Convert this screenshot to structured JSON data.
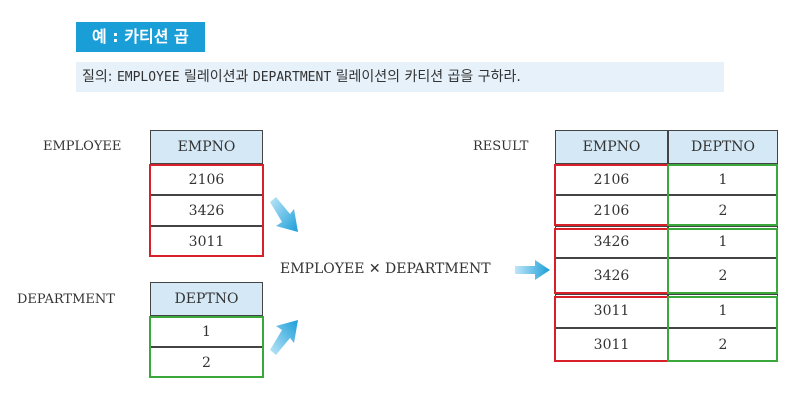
{
  "example_title": "예 : 카티션 곱",
  "query": {
    "prefix": "질의: ",
    "rel1": "EMPLOYEE",
    "mid": " 릴레이션과 ",
    "rel2": "DEPARTMENT",
    "suffix": " 릴레이션의 카티션 곱을 구하라."
  },
  "employee": {
    "label": "EMPLOYEE",
    "header": "EMPNO",
    "rows": [
      "2106",
      "3426",
      "3011"
    ]
  },
  "department": {
    "label": "DEPARTMENT",
    "header": "DEPTNO",
    "rows": [
      "1",
      "2"
    ]
  },
  "operation": "EMPLOYEE ✕ DEPARTMENT",
  "result": {
    "label": "RESULT",
    "headers": [
      "EMPNO",
      "DEPTNO"
    ],
    "rows": [
      [
        "2106",
        "1"
      ],
      [
        "2106",
        "2"
      ],
      [
        "3426",
        "1"
      ],
      [
        "3426",
        "2"
      ],
      [
        "3011",
        "1"
      ],
      [
        "3011",
        "2"
      ]
    ]
  },
  "colors": {
    "accent": "#1a9ed8",
    "query_bg": "#e6f1fa",
    "header_bg": "#d4e8f6",
    "employee_group": "#d8202a",
    "department_group": "#3aa83a"
  },
  "icons": [
    "arrow-down-right-icon",
    "arrow-right-icon",
    "arrow-up-right-icon"
  ]
}
